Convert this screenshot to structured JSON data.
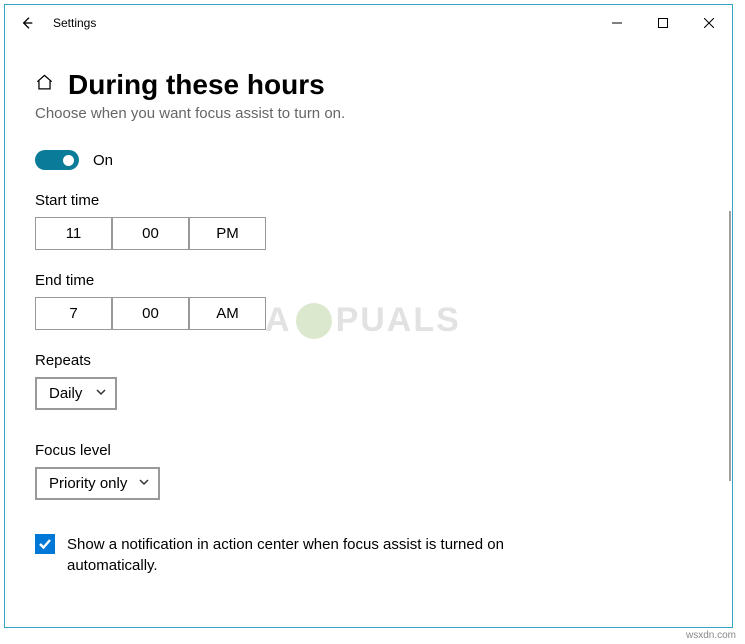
{
  "titlebar": {
    "title": "Settings"
  },
  "page": {
    "heading": "During these hours",
    "subtitle": "Choose when you want focus assist to turn on."
  },
  "toggle": {
    "label": "On",
    "state": true
  },
  "start_time": {
    "label": "Start time",
    "hour": "11",
    "minute": "00",
    "period": "PM"
  },
  "end_time": {
    "label": "End time",
    "hour": "7",
    "minute": "00",
    "period": "AM"
  },
  "repeats": {
    "label": "Repeats",
    "value": "Daily"
  },
  "focus_level": {
    "label": "Focus level",
    "value": "Priority only"
  },
  "checkbox": {
    "checked": true,
    "text": "Show a notification in action center when focus assist is turned on automatically."
  },
  "accent_color": "#0078d7",
  "watermark": "wsxdn.com",
  "watermark_left": "A",
  "watermark_right": "PUALS"
}
